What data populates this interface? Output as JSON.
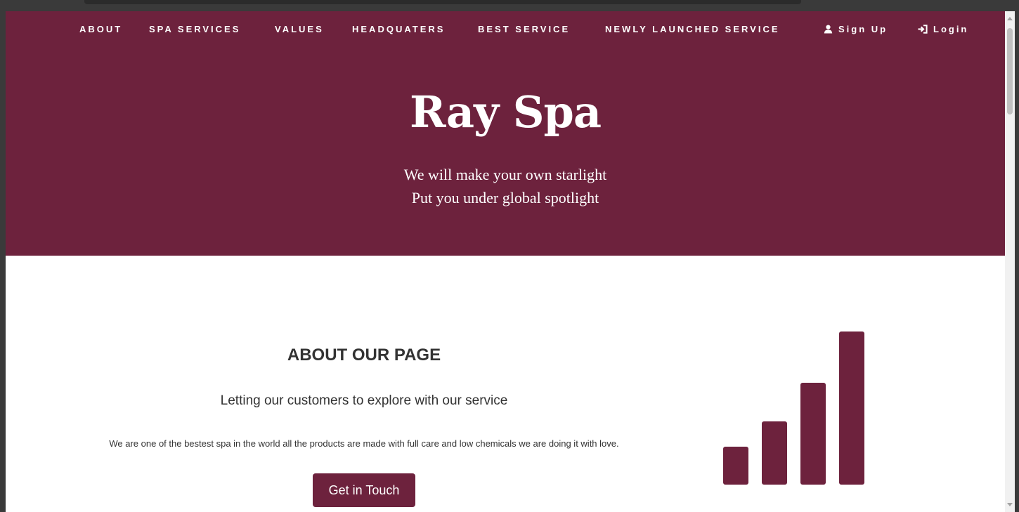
{
  "nav": {
    "items": [
      {
        "label": "ABOUT"
      },
      {
        "label": "SPA SERVICES"
      },
      {
        "label": "VALUES"
      },
      {
        "label": "HEADQUATERS"
      },
      {
        "label": "BEST SERVICE"
      },
      {
        "label": "NEWLY LAUNCHED SERVICE"
      }
    ],
    "signup": {
      "label": "Sign Up",
      "icon": "user-icon"
    },
    "login": {
      "label": "Login",
      "icon": "login-icon"
    }
  },
  "hero": {
    "title": "Ray Spa",
    "subtitle_line1": "We will make your own starlight",
    "subtitle_line2": "Put you under global spotlight"
  },
  "about": {
    "heading": "ABOUT OUR PAGE",
    "tagline": "Letting our customers to explore with our service",
    "text": "We are one of the bestest spa in the world all the products are made with full care and low chemicals we are doing it with love.",
    "button_label": "Get in Touch",
    "graphic_icon": "signal-bars-icon"
  },
  "colors": {
    "brand": "#6d223d",
    "text": "#333333",
    "background": "#ffffff"
  }
}
